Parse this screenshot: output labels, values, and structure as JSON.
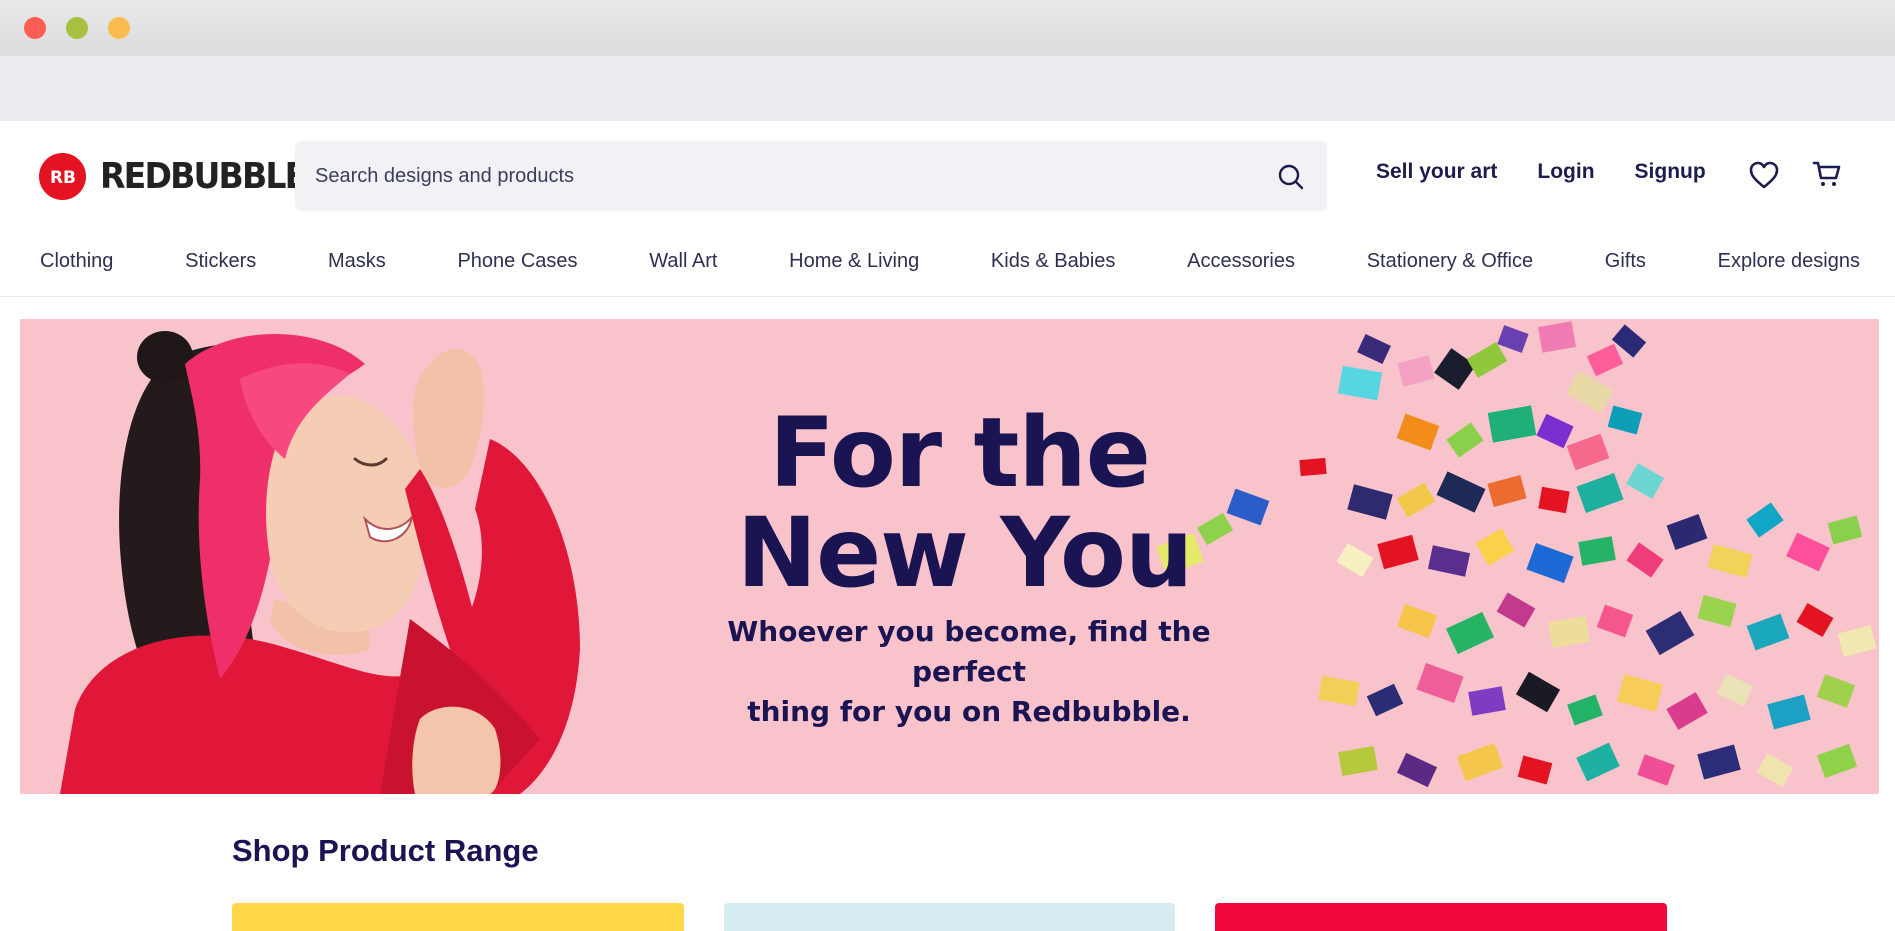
{
  "brand": {
    "logo_initials": "RB",
    "name": "REDBUBBLE",
    "accent_color": "#e41321",
    "navy_color": "#1b1452"
  },
  "search": {
    "placeholder": "Search designs and products",
    "icon": "search-icon"
  },
  "header_links": {
    "sell": "Sell your art",
    "login": "Login",
    "signup": "Signup"
  },
  "header_icons": [
    "heart-icon",
    "cart-icon"
  ],
  "categories": [
    "Clothing",
    "Stickers",
    "Masks",
    "Phone Cases",
    "Wall Art",
    "Home & Living",
    "Kids & Babies",
    "Accessories",
    "Stationery & Office",
    "Gifts",
    "Explore designs"
  ],
  "hero": {
    "title_line1": "For the",
    "title_line2": "New You",
    "subtitle_line1": "Whoever you become, find the perfect",
    "subtitle_line2": "thing for you on Redbubble.",
    "background_color": "#f8c3cb"
  },
  "product_range": {
    "title": "Shop Product Range",
    "card_colors": [
      "#ffd84a",
      "#d7ecf0",
      "#f2083d"
    ]
  }
}
